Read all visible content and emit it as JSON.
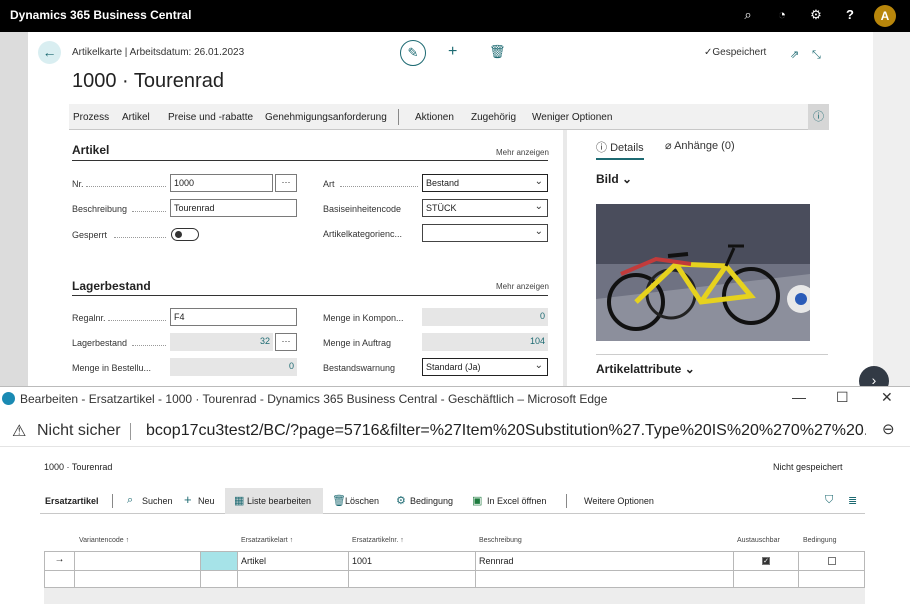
{
  "appbar": {
    "title": "Dynamics 365 Business Central",
    "icons": [
      "search-icon",
      "bell-icon",
      "gear-icon",
      "help-icon"
    ],
    "avatar_initial": "A"
  },
  "card": {
    "breadcrumb": "Artikelkarte | Arbeitsdatum: 26.01.2023",
    "title": "1000 · Tourenrad",
    "saved_status": "Gespeichert",
    "actions": [
      "Prozess",
      "Artikel",
      "Preise und -rabatte",
      "Genehmigungsanforderung",
      "Aktionen",
      "Zugehörig",
      "Weniger Optionen"
    ],
    "sections": {
      "artikel": {
        "title": "Artikel",
        "more": "Mehr anzeigen",
        "fields": {
          "nr": {
            "label": "Nr.",
            "value": "1000"
          },
          "beschreibung": {
            "label": "Beschreibung",
            "value": "Tourenrad"
          },
          "gesperrt": {
            "label": "Gesperrt",
            "value": false
          },
          "art": {
            "label": "Art",
            "value": "Bestand"
          },
          "basiseinheit": {
            "label": "Basiseinheitencode",
            "value": "STÜCK"
          },
          "kategorie": {
            "label": "Artikelkategorienc...",
            "value": ""
          }
        }
      },
      "lager": {
        "title": "Lagerbestand",
        "more": "Mehr anzeigen",
        "fields": {
          "regalnr": {
            "label": "Regalnr.",
            "value": "F4"
          },
          "lagerbestand": {
            "label": "Lagerbestand",
            "value": "32"
          },
          "menge_bestell": {
            "label": "Menge in Bestellu...",
            "value": "0"
          },
          "menge_kompon": {
            "label": "Menge in Kompon...",
            "value": "0"
          },
          "menge_auftrag": {
            "label": "Menge in Auftrag",
            "value": "104"
          },
          "bestandswarnung": {
            "label": "Bestandswarnung",
            "value": "Standard (Ja)"
          }
        }
      }
    },
    "factbox": {
      "tab_details": "Details",
      "tab_anhaenge": "Anhänge (0)",
      "bild": "Bild",
      "artikelattribute": "Artikelattribute"
    }
  },
  "edge": {
    "window_title": "Bearbeiten - Ersatzartikel - 1000 · Tourenrad - Dynamics 365 Business Central - Geschäftlich – Microsoft Edge",
    "not_secure": "Nicht sicher",
    "url": "bcop17cu3test2/BC/?page=5716&filter=%27Item%20Substitution%27.Type%20IS%20%270%27%20...",
    "page_title": "1000 · Tourenrad",
    "saved_status": "Nicht gespeichert",
    "actions": {
      "label": "Ersatzartikel",
      "suchen": "Suchen",
      "neu": "Neu",
      "liste": "Liste bearbeiten",
      "loeschen": "Löschen",
      "bedingung": "Bedingung",
      "excel": "In Excel öffnen",
      "weitere": "Weitere Optionen"
    },
    "grid": {
      "headers": [
        "Variantencode ↑",
        "Ersatzartikelart ↑",
        "Ersatzartikelnr. ↑",
        "Beschreibung",
        "Austauschbar",
        "Bedingung"
      ],
      "row": {
        "variantencode": "",
        "art": "Artikel",
        "nr": "1001",
        "beschreibung": "Rennrad",
        "austauschbar": true,
        "bedingung": false
      }
    }
  },
  "colors": {
    "accent": "#1d6a72",
    "appbar": "#000000",
    "highlight_cell": "#a6e3e8"
  }
}
